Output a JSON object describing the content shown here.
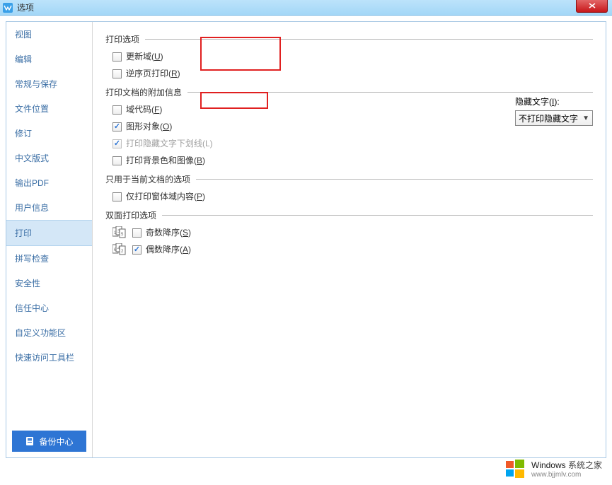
{
  "titlebar": {
    "title": "选项"
  },
  "sidebar": {
    "items": [
      "视图",
      "编辑",
      "常规与保存",
      "文件位置",
      "修订",
      "中文版式",
      "输出PDF",
      "用户信息",
      "打印",
      "拼写检查",
      "安全性",
      "信任中心",
      "自定义功能区",
      "快速访问工具栏"
    ],
    "selected_index": 8,
    "backup_label": "备份中心"
  },
  "main": {
    "section_print_options": {
      "title": "打印选项",
      "update_fields": {
        "label_pre": "更新域(",
        "mn": "U",
        "label_post": ")",
        "checked": false
      },
      "reverse_order": {
        "label_pre": "逆序页打印(",
        "mn": "R",
        "label_post": ")",
        "checked": false
      }
    },
    "section_extra": {
      "title": "打印文档的附加信息",
      "field_codes": {
        "label_pre": "域代码(",
        "mn": "F",
        "label_post": ")",
        "checked": false
      },
      "drawing_objects": {
        "label_pre": "图形对象(",
        "mn": "O",
        "label_post": ")",
        "checked": true
      },
      "hidden_underline": {
        "label": "打印隐藏文字下划线(L)",
        "checked": true,
        "disabled": true
      },
      "background": {
        "label_pre": "打印背景色和图像(",
        "mn": "B",
        "label_post": ")",
        "checked": false
      },
      "hidden_text_label_pre": "隐藏文字(",
      "hidden_text_mn": "I",
      "hidden_text_label_post": "):",
      "hidden_text_value": "不打印隐藏文字"
    },
    "section_current_doc": {
      "title": "只用于当前文档的选项",
      "form_fields": {
        "label_pre": "仅打印窗体域内容(",
        "mn": "P",
        "label_post": ")",
        "checked": false
      }
    },
    "section_duplex": {
      "title": "双面打印选项",
      "odd_desc": {
        "label_pre": "奇数降序(",
        "mn": "S",
        "label_post": ")",
        "checked": false
      },
      "even_desc": {
        "label_pre": "偶数降序(",
        "mn": "A",
        "label_post": ")",
        "checked": true
      }
    }
  },
  "watermark": {
    "brand": "Windows",
    "suffix": "系统之家",
    "url": "www.bjjmlv.com"
  }
}
